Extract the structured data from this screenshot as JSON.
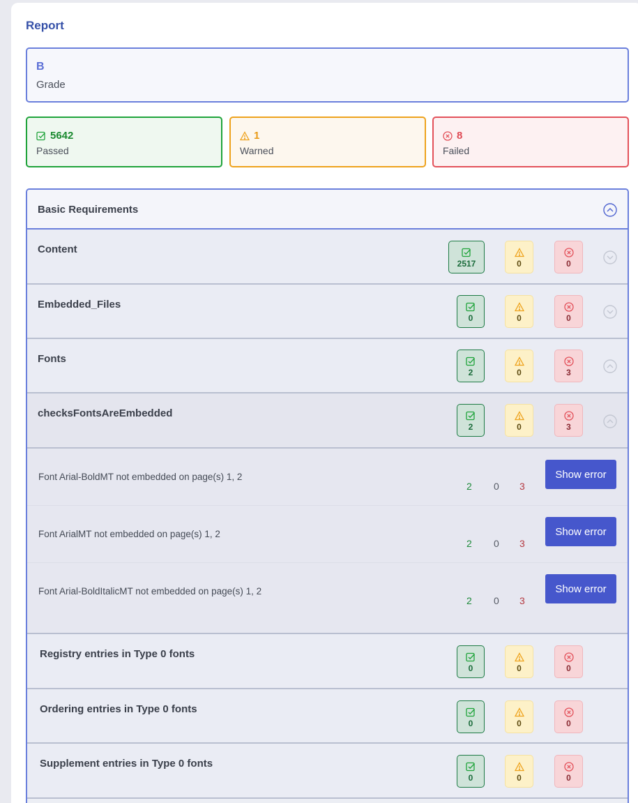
{
  "report": {
    "title": "Report",
    "grade": {
      "value": "B",
      "label": "Grade"
    },
    "summary": {
      "passed": {
        "value": "5642",
        "label": "Passed"
      },
      "warned": {
        "value": "1",
        "label": "Warned"
      },
      "failed": {
        "value": "8",
        "label": "Failed"
      }
    }
  },
  "section": {
    "title": "Basic Requirements",
    "rows": [
      {
        "title": "Content",
        "passed": "2517",
        "warned": "0",
        "failed": "0"
      },
      {
        "title": "Embedded_Files",
        "passed": "0",
        "warned": "0",
        "failed": "0"
      },
      {
        "title": "Fonts",
        "passed": "2",
        "warned": "0",
        "failed": "3"
      },
      {
        "title": "checksFontsAreEmbedded",
        "passed": "2",
        "warned": "0",
        "failed": "3"
      }
    ],
    "details": [
      {
        "message": "Font Arial-BoldMT not embedded on page(s) 1, 2",
        "passed": "2",
        "warned": "0",
        "failed": "3",
        "button": "Show error"
      },
      {
        "message": "Font ArialMT not embedded on page(s) 1, 2",
        "passed": "2",
        "warned": "0",
        "failed": "3",
        "button": "Show error"
      },
      {
        "message": "Font Arial-BoldItalicMT not embedded on page(s) 1, 2",
        "passed": "2",
        "warned": "0",
        "failed": "3",
        "button": "Show error"
      }
    ],
    "subrows": [
      {
        "title": "Registry entries in Type 0 fonts",
        "passed": "0",
        "warned": "0",
        "failed": "0"
      },
      {
        "title": "Ordering entries in Type 0 fonts",
        "passed": "0",
        "warned": "0",
        "failed": "0"
      },
      {
        "title": "Supplement entries in Type 0 fonts",
        "passed": "0",
        "warned": "0",
        "failed": "0"
      }
    ]
  },
  "colors": {
    "accent": "#6a7fdc",
    "button": "#4657cc",
    "passed": "#1fa33a",
    "warned": "#eea21c",
    "failed": "#e3515a"
  },
  "icons": {
    "passed": "check-square-icon",
    "warned": "warning-triangle-icon",
    "failed": "x-circle-icon",
    "expand": "chevron-circle-icon"
  }
}
